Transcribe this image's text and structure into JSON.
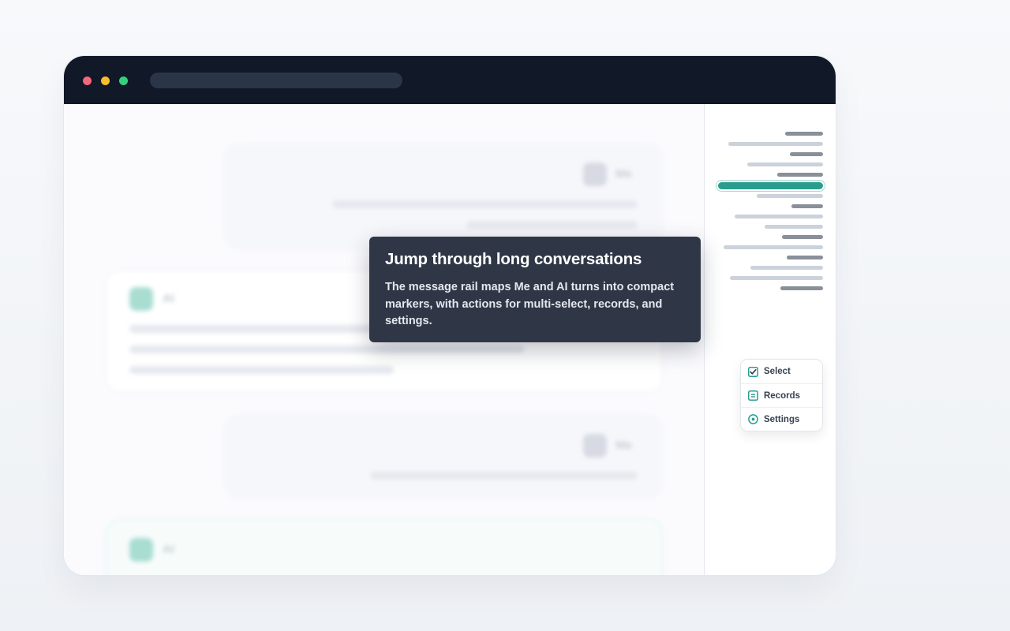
{
  "chat": {
    "messages": [
      {
        "role": "me",
        "sender": "Me"
      },
      {
        "role": "ai",
        "sender": "AI"
      },
      {
        "role": "me",
        "sender": "Me"
      },
      {
        "role": "ai",
        "sender": "AI"
      }
    ]
  },
  "rail": {
    "actions": [
      {
        "label": "Select",
        "icon": "checkbox-icon"
      },
      {
        "label": "Records",
        "icon": "document-icon"
      },
      {
        "label": "Settings",
        "icon": "gear-icon"
      }
    ]
  },
  "tooltip": {
    "title": "Jump through long conversations",
    "body": "The message rail maps Me and AI turns into compact markers, with actions for multi-select, records, and settings."
  },
  "colors": {
    "accent": "#2a9d8f",
    "titlebar": "#111827",
    "tooltip_bg": "#2f3747"
  }
}
